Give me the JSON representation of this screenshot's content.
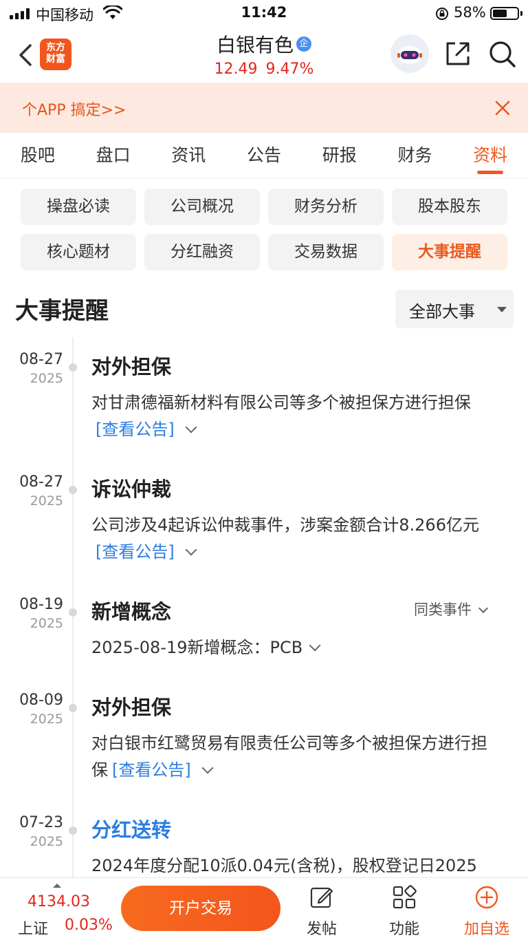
{
  "status_bar": {
    "carrier": "中国移动",
    "time": "11:42",
    "battery_percent": "58%",
    "battery_level": 0.58
  },
  "header": {
    "logo_line1": "东方",
    "logo_line2": "财富",
    "stock_name": "白银有色",
    "badge": "企",
    "price": "12.49",
    "change_percent": "9.47%"
  },
  "banner": {
    "text": "个APP 搞定>>"
  },
  "tabs": [
    {
      "label": "股吧"
    },
    {
      "label": "盘口"
    },
    {
      "label": "资讯"
    },
    {
      "label": "公告"
    },
    {
      "label": "研报"
    },
    {
      "label": "财务"
    },
    {
      "label": "资料",
      "active": true
    }
  ],
  "sub_nav": [
    {
      "label": "操盘必读"
    },
    {
      "label": "公司概况"
    },
    {
      "label": "财务分析"
    },
    {
      "label": "股本股东"
    },
    {
      "label": "核心题材"
    },
    {
      "label": "分红融资"
    },
    {
      "label": "交易数据"
    },
    {
      "label": "大事提醒",
      "active": true
    }
  ],
  "section": {
    "title": "大事提醒",
    "filter_label": "全部大事"
  },
  "events": [
    {
      "date": "08-27",
      "year": "2025",
      "title": "对外担保",
      "desc": "对甘肃德福新材料有限公司等多个被担保方进行担保",
      "link": "[查看公告]"
    },
    {
      "date": "08-27",
      "year": "2025",
      "title": "诉讼仲裁",
      "desc": "公司涉及4起诉讼仲裁事件，涉案金额合计8.266亿元",
      "link": "[查看公告]"
    },
    {
      "date": "08-19",
      "year": "2025",
      "title": "新增概念",
      "desc": "2025-08-19新增概念：PCB",
      "link": "",
      "similar": "同类事件"
    },
    {
      "date": "08-09",
      "year": "2025",
      "title": "对外担保",
      "desc": "对白银市红鹭贸易有限责任公司等多个被担保方进行担保",
      "link": "[查看公告]"
    },
    {
      "date": "07-23",
      "year": "2025",
      "title": "分红送转",
      "desc": "2024年度分配10派0.04元(含税)，股权登记日2025",
      "link": ""
    }
  ],
  "bottom_bar": {
    "index_value": "4134.03",
    "index_name": "上证",
    "index_change": "0.03%",
    "open_account": "开户交易",
    "post": "发帖",
    "functions": "功能",
    "add_watch": "加自选"
  },
  "colors": {
    "accent": "#f2561d",
    "up_red": "#e3261c",
    "link_blue": "#2a7de1",
    "banner_bg": "#fde9e0"
  }
}
